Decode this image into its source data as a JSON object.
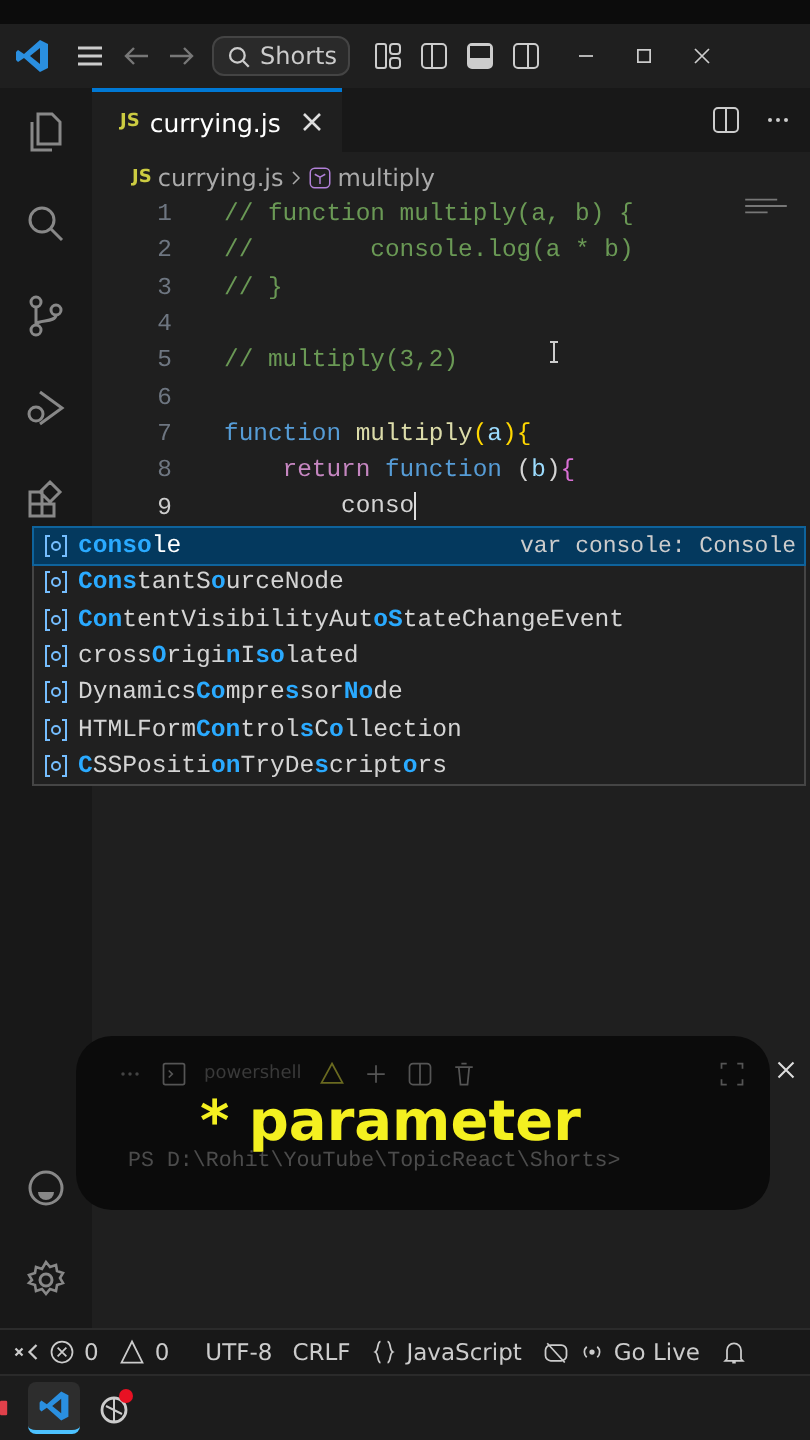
{
  "title_bar": {
    "search": "Shorts"
  },
  "tabs": [
    {
      "label": "currying.js",
      "badge": "JS",
      "selected": true
    }
  ],
  "breadcrumb": {
    "badge": "JS",
    "file": "currying.js",
    "symbol": "multiply"
  },
  "editor": {
    "lines": [
      {
        "number": "1",
        "tokens": [
          {
            "text": "// function multiply(a, b) {",
            "kind": "comment"
          }
        ]
      },
      {
        "number": "2",
        "tokens": [
          {
            "text": "//        console.log(a * b)",
            "kind": "comment"
          }
        ]
      },
      {
        "number": "3",
        "tokens": [
          {
            "text": "// }",
            "kind": "comment"
          }
        ]
      },
      {
        "number": "4"
      },
      {
        "number": "5",
        "tokens": [
          {
            "text": "// multiply(3,2)",
            "kind": "comment"
          }
        ]
      },
      {
        "number": "6"
      },
      {
        "number": "7",
        "tokens": [
          {
            "text": "function",
            "kind": "keyword"
          },
          {
            "text": " multiply",
            "kind": "func"
          },
          {
            "text": "(",
            "kind": "bracket"
          },
          {
            "text": "a",
            "kind": "param"
          },
          {
            "text": "){",
            "kind": "bracket"
          }
        ]
      },
      {
        "number": "8",
        "tokens": [
          {
            "text": "    return",
            "kind": "control"
          },
          {
            "text": " function",
            "kind": "keyword"
          },
          {
            "text": " (",
            "kind": "plain"
          },
          {
            "text": "b",
            "kind": "param"
          },
          {
            "text": ")",
            "kind": "plain"
          },
          {
            "text": "{",
            "kind": "bracket2"
          }
        ]
      },
      {
        "number": "9",
        "current": true,
        "tokens": [
          {
            "text": "        conso",
            "kind": "plain"
          }
        ]
      }
    ]
  },
  "suggestions": [
    {
      "selected": true,
      "detail": "var console: Console",
      "parts": [
        {
          "text": "conso",
          "match": true
        },
        {
          "text": "le",
          "match": false
        }
      ]
    },
    {
      "selected": false,
      "parts": [
        {
          "text": "Cons",
          "match": true
        },
        {
          "text": "tantS",
          "match": false
        },
        {
          "text": "o",
          "match": true
        },
        {
          "text": "urceNode",
          "match": false
        }
      ]
    },
    {
      "selected": false,
      "parts": [
        {
          "text": "Con",
          "match": true
        },
        {
          "text": "tentVisibilityAut",
          "match": false
        },
        {
          "text": "oS",
          "match": true
        },
        {
          "text": "tateChangeEvent",
          "match": false
        }
      ]
    },
    {
      "selected": false,
      "parts": [
        {
          "text": "cross",
          "match": false
        },
        {
          "text": "O",
          "match": true
        },
        {
          "text": "rigi",
          "match": false
        },
        {
          "text": "n",
          "match": true
        },
        {
          "text": "I",
          "match": false
        },
        {
          "text": "so",
          "match": true
        },
        {
          "text": "lated",
          "match": false
        }
      ]
    },
    {
      "selected": false,
      "parts": [
        {
          "text": "Dynamics",
          "match": false
        },
        {
          "text": "Co",
          "match": true
        },
        {
          "text": "mpre",
          "match": false
        },
        {
          "text": "s",
          "match": true
        },
        {
          "text": "sor",
          "match": false
        },
        {
          "text": "No",
          "match": true
        },
        {
          "text": "de",
          "match": false
        }
      ]
    },
    {
      "selected": false,
      "parts": [
        {
          "text": "HTMLForm",
          "match": false
        },
        {
          "text": "Con",
          "match": true
        },
        {
          "text": "trol",
          "match": false
        },
        {
          "text": "s",
          "match": true
        },
        {
          "text": "C",
          "match": false
        },
        {
          "text": "o",
          "match": true
        },
        {
          "text": "llection",
          "match": false
        }
      ]
    },
    {
      "selected": false,
      "parts": [
        {
          "text": "C",
          "match": true
        },
        {
          "text": "SSPositi",
          "match": false
        },
        {
          "text": "on",
          "match": true
        },
        {
          "text": "TryDe",
          "match": false
        },
        {
          "text": "s",
          "match": true
        },
        {
          "text": "cript",
          "match": false
        },
        {
          "text": "o",
          "match": true
        },
        {
          "text": "rs",
          "match": false
        }
      ]
    }
  ],
  "terminal": {
    "shell": "powershell",
    "prompt": "PS D:\\Rohit\\YouTube\\TopicReact\\Shorts>"
  },
  "caption": "* parameter",
  "status_bar": {
    "errors": "0",
    "warnings": "0",
    "encoding": "UTF-8",
    "eol": "CRLF",
    "language": "JavaScript",
    "live": "Go Live"
  }
}
